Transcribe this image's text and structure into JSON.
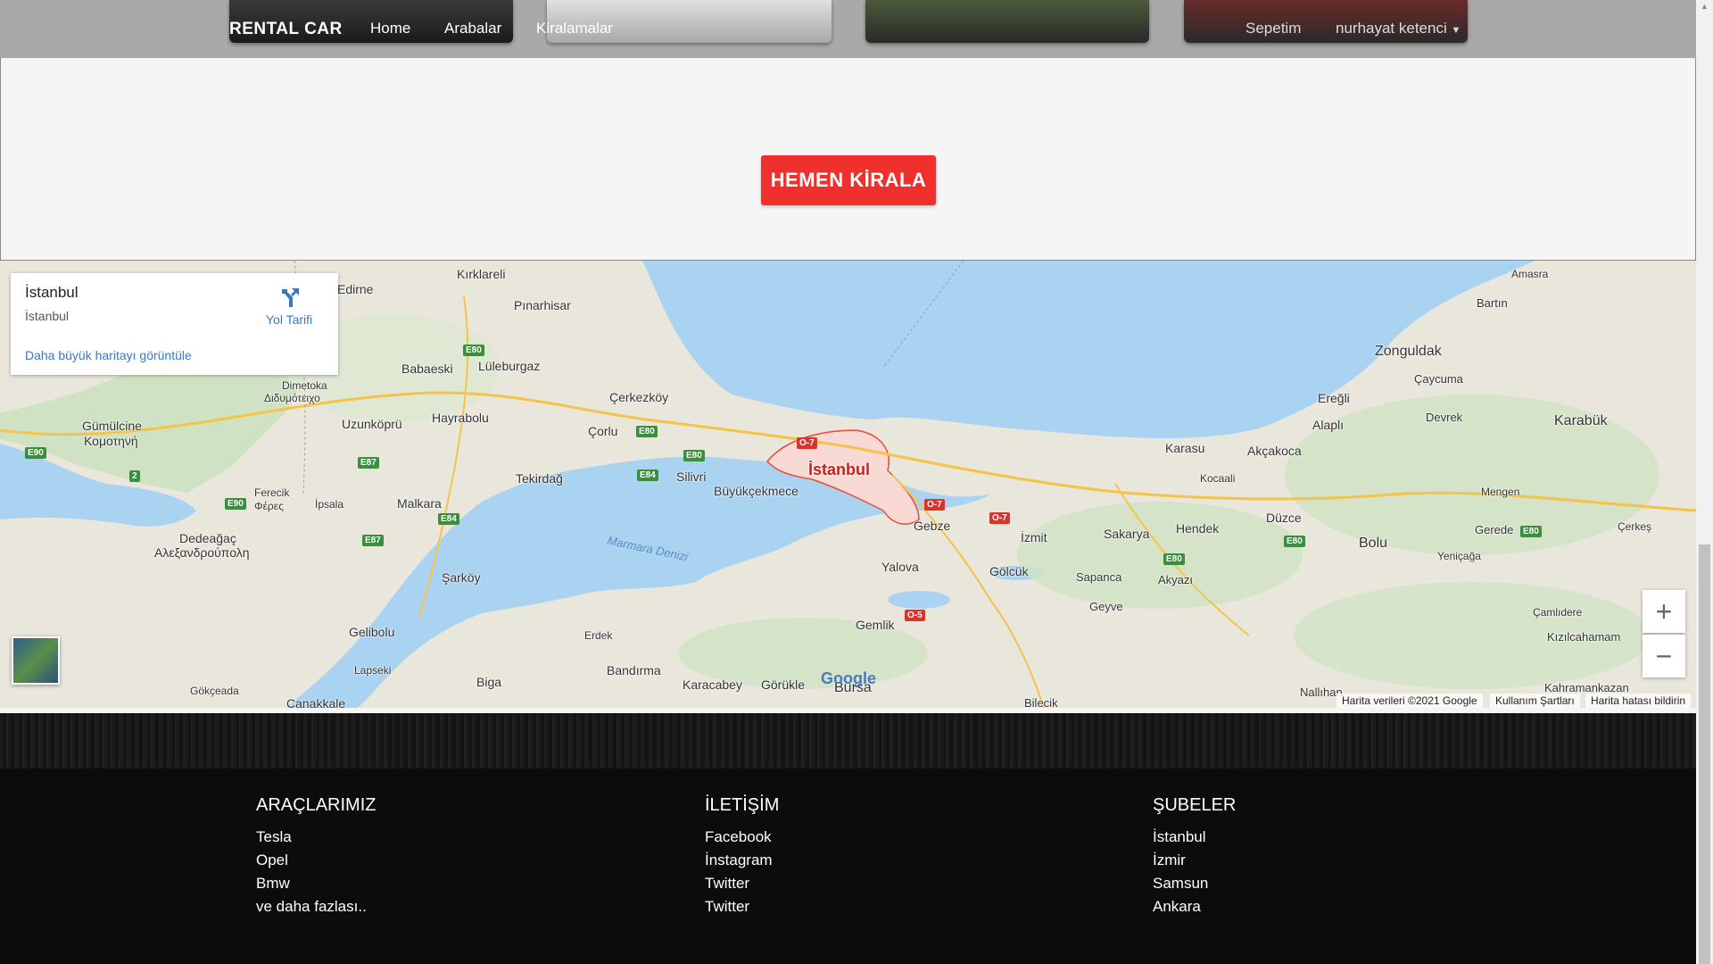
{
  "nav": {
    "brand": "RENTAL CAR",
    "links": [
      "Home",
      "Arabalar",
      "Kiralamalar"
    ],
    "cart": "Sepetim",
    "user": "nurhayat ketenci"
  },
  "hero": {
    "cta": "HEMEN KİRALA"
  },
  "map": {
    "place_title": "İstanbul",
    "place_subtitle": "İstanbul",
    "directions": "Yol Tarifi",
    "larger_map": "Daha büyük haritayı görüntüle",
    "attribution": [
      "Harita verileri ©2021 Google",
      "Kullanım Şartları",
      "Harita hatası bildirin"
    ],
    "logo": "Google",
    "labels": [
      "Kırklareli",
      "Pınarhisar",
      "Lüleburgaz",
      "Babaeski",
      "Edirne",
      "Dimetoka",
      "Διδυμότειχο",
      "Çerkezköy",
      "Hayrabolu",
      "Uzunköprü",
      "Gümülcine",
      "Κομοτηνή",
      "Çorlu",
      "Silivri",
      "Tekirdağ",
      "Malkara",
      "İpsala",
      "Ferecik",
      "Φέρες",
      "Dedeağaç",
      "Αλεξανδρούπολη",
      "Büyükçekmece",
      "İstanbul",
      "Marmara Denizi",
      "Şarköy",
      "Gelibolu",
      "Lapseki",
      "Çanakkale",
      "Gökçeada",
      "Biga",
      "Erdek",
      "Bandırma",
      "Karacabey",
      "Görükle",
      "Bursa",
      "Gemlik",
      "Yalova",
      "Gölcük",
      "Gebze",
      "İzmit",
      "Sakarya",
      "Sapanca",
      "Geyve",
      "Hendek",
      "Akyazı",
      "Karasu",
      "Kocaali",
      "Akçakoca",
      "Düzce",
      "Bolu",
      "Ereğli",
      "Alaplı",
      "Devrek",
      "Zonguldak",
      "Çaycuma",
      "Bartın",
      "Amasra",
      "Karabük",
      "Mengen",
      "Gerede",
      "Yeniçağa",
      "Çerkeş",
      "Çamlıdere",
      "Kızılcahamam",
      "Kahramankazan",
      "Nallıhan",
      "Bilecik",
      "Sakarya"
    ],
    "roads": [
      "E80",
      "E87",
      "E84",
      "E90",
      "E80",
      "E80",
      "E84",
      "O-7",
      "O-7",
      "O-7",
      "O-5",
      "E80",
      "E80",
      "E80",
      "E90",
      "E87",
      "2"
    ]
  },
  "footer": {
    "columns": [
      {
        "title": "ARAÇLARIMIZ",
        "items": [
          "Tesla",
          "Opel",
          "Bmw",
          "ve daha fazlası.."
        ]
      },
      {
        "title": "İLETİŞİM",
        "items": [
          "Facebook",
          "İnstagram",
          "Twitter",
          "Twitter"
        ]
      },
      {
        "title": "ŞUBELER",
        "items": [
          "İstanbul",
          "İzmir",
          "Samsun",
          "Ankara"
        ]
      }
    ]
  },
  "colors": {
    "cta": "#f0302c",
    "footer": "#0c0c0c",
    "link": "#3b78c4",
    "sea": "#aad3f2"
  }
}
